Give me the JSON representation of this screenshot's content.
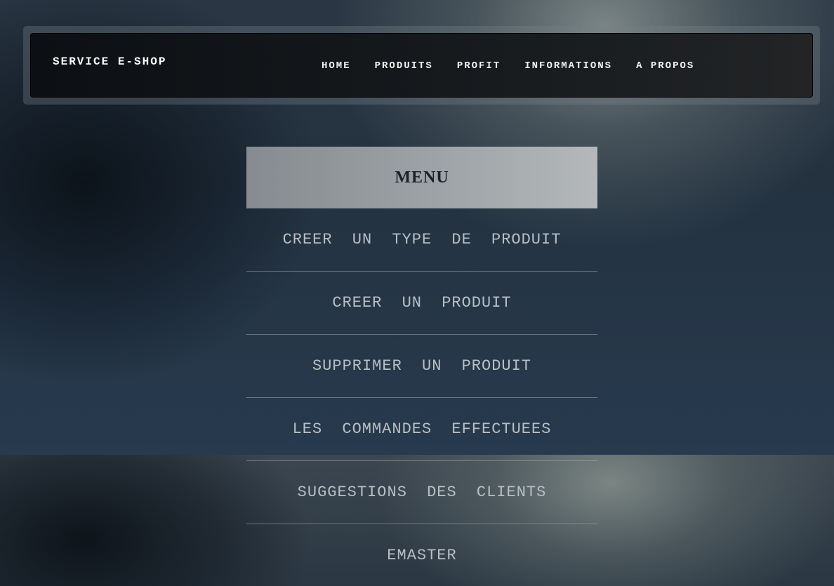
{
  "navbar": {
    "brand": "SERVICE E-SHOP",
    "links": [
      "HOME",
      "PRODUITS",
      "PROFIT",
      "INFORMATIONS",
      "A PROPOS"
    ]
  },
  "menu": {
    "title": "MENU",
    "items": [
      "CREER UN TYPE DE PRODUIT",
      "CREER UN PRODUIT",
      "SUPPRIMER UN PRODUIT",
      "LES COMMANDES EFFECTUEES",
      "SUGGESTIONS DES CLIENTS",
      "EMASTER"
    ]
  },
  "colors": {
    "navbar_bg": "#111518",
    "menu_header_bg": "#9ea3a7",
    "menu_text": "#b9bfc4",
    "page_bg": "#243240"
  }
}
